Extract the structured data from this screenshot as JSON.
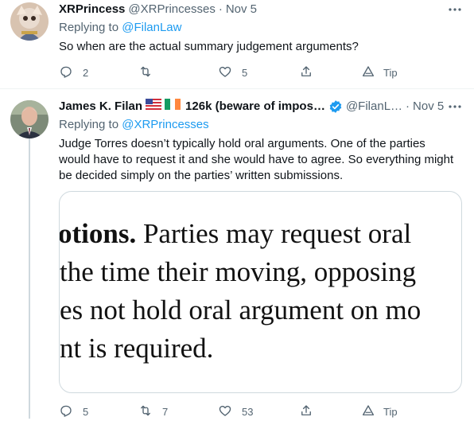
{
  "tweets": [
    {
      "name": "XRPrincess",
      "handle": "@XRPrincesses",
      "date": "Nov 5",
      "replying_prefix": "Replying to",
      "replying_to": "@FilanLaw",
      "text": "So when are the actual summary judgement arguments?",
      "actions": {
        "reply": "2",
        "retweet": "",
        "like": "5",
        "tip": "Tip"
      }
    },
    {
      "name": "James K. Filan",
      "name_suffix": "126k (beware of impos…",
      "handle": "@FilanL…",
      "date": "Nov 5",
      "replying_prefix": "Replying to",
      "replying_to": "@XRPrincesses",
      "text_lines": [
        "Judge Torres doesn’t typically hold oral arguments.  One of the parties",
        "would have to request it and she would have to agree.  So everything might",
        "be decided simply on the parties’ written submissions."
      ],
      "document_lines": [
        {
          "bold": "otions.",
          "rest": " Parties may request oral"
        },
        {
          "bold": "",
          "rest": "the time their moving, opposing"
        },
        {
          "bold": "",
          "rest": "es not hold oral argument on mo"
        },
        {
          "bold": "",
          "rest": "nt is required."
        }
      ],
      "actions": {
        "reply": "5",
        "retweet": "7",
        "like": "53",
        "tip": "Tip"
      }
    }
  ],
  "colors": {
    "text": "#0f1419",
    "secondary": "#536471",
    "link": "#1d9bf0",
    "border": "#cfd9de",
    "verified": "#1d9bf0"
  }
}
